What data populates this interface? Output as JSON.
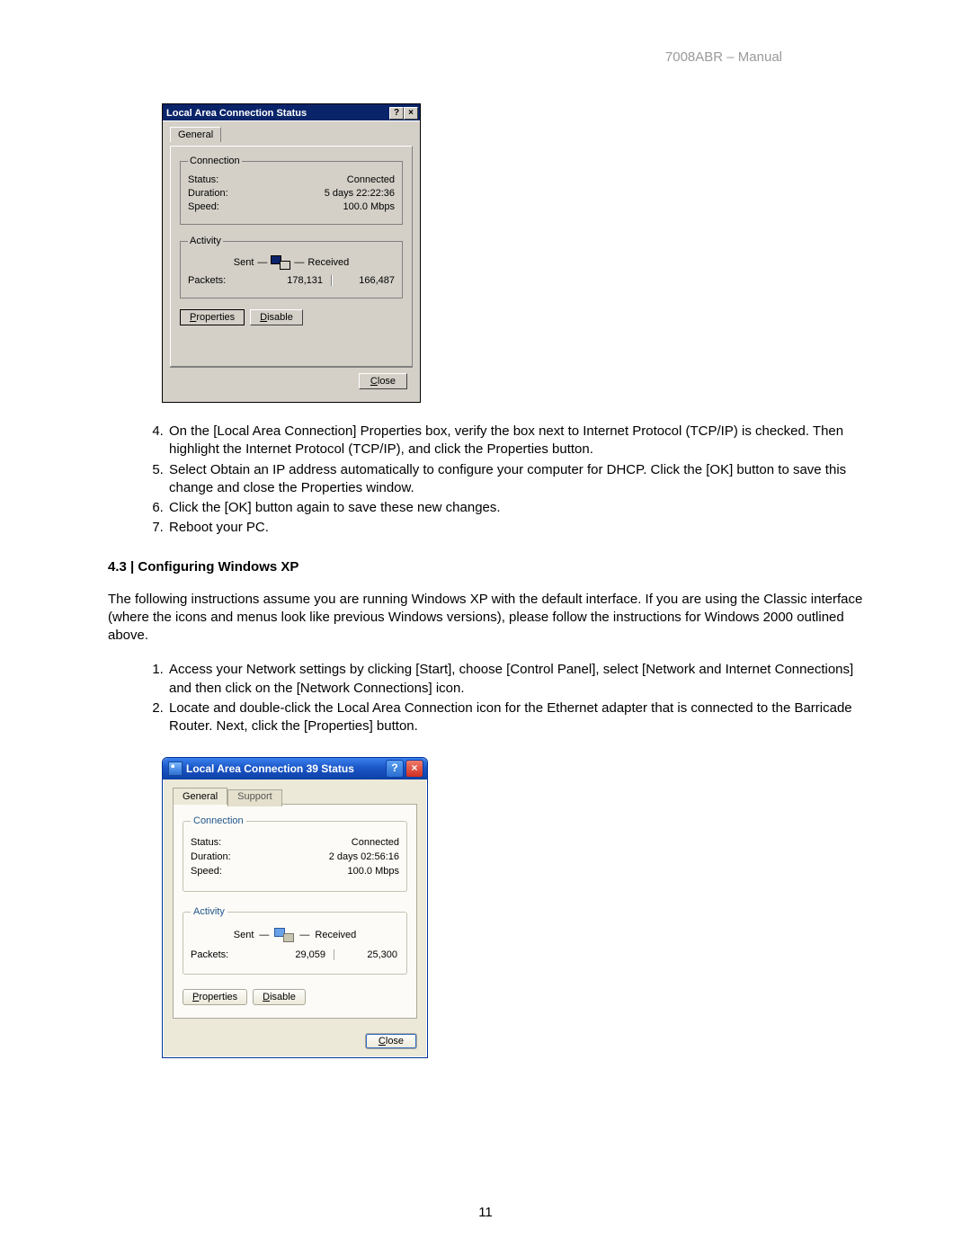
{
  "header": {
    "doc_label": "7008ABR – Manual"
  },
  "dialog2k": {
    "title": "Local Area Connection Status",
    "help_char": "?",
    "close_char": "×",
    "tab": "General",
    "group_conn_legend": "Connection",
    "conn": {
      "status_lbl": "Status:",
      "status_val": "Connected",
      "duration_lbl": "Duration:",
      "duration_val": "5 days 22:22:36",
      "speed_lbl": "Speed:",
      "speed_val": "100.0 Mbps"
    },
    "group_act_legend": "Activity",
    "act": {
      "sent_lbl": "Sent",
      "recv_lbl": "Received",
      "packets_lbl": "Packets:",
      "packets_sent": "178,131",
      "packets_recv": "166,487"
    },
    "btn_properties": "Properties",
    "btn_disable": "Disable",
    "btn_close": "Close"
  },
  "steps_a": {
    "start": 4,
    "items": [
      "On the [Local Area Connection] Properties box, verify the box next to Internet Protocol (TCP/IP) is checked. Then highlight the Internet Protocol (TCP/IP), and click the Properties button.",
      "Select Obtain an IP address automatically to configure your computer for DHCP. Click the [OK] button to save this change and close the Properties window.",
      "Click the [OK] button again to save these new changes.",
      "Reboot your PC."
    ]
  },
  "section_heading": "4.3 | Configuring Windows XP",
  "section_intro": "The following instructions assume you are running Windows XP with the default interface. If you are using the Classic interface (where the icons and menus look like previous Windows versions), please follow the instructions for Windows 2000 outlined above.",
  "steps_b": {
    "start": 1,
    "items": [
      "Access your Network settings by clicking [Start], choose [Control Panel], select [Network and Internet Connections] and then click on the [Network Connections] icon.",
      "Locate and double-click the Local Area Connection icon for the Ethernet adapter that is connected to the Barricade Router. Next, click the [Properties] button."
    ]
  },
  "dialogXP": {
    "title": "Local Area Connection 39 Status",
    "help_char": "?",
    "close_char": "×",
    "tab_general": "General",
    "tab_support": "Support",
    "group_conn_legend": "Connection",
    "conn": {
      "status_lbl": "Status:",
      "status_val": "Connected",
      "duration_lbl": "Duration:",
      "duration_val": "2 days 02:56:16",
      "speed_lbl": "Speed:",
      "speed_val": "100.0 Mbps"
    },
    "group_act_legend": "Activity",
    "act": {
      "sent_lbl": "Sent",
      "recv_lbl": "Received",
      "packets_lbl": "Packets:",
      "packets_sent": "29,059",
      "packets_recv": "25,300"
    },
    "btn_properties": "Properties",
    "btn_disable": "Disable",
    "btn_close": "Close"
  },
  "page_number": "11"
}
